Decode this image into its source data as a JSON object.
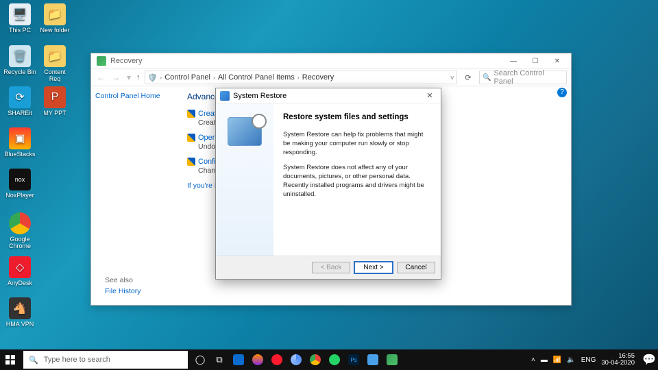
{
  "desktop_icons": {
    "this_pc": "This PC",
    "new_folder": "New folder",
    "recycle_bin": "Recycle Bin",
    "content_req": "Content Req",
    "shareit": "SHAREit",
    "my_ppt": "MY PPT",
    "bluestacks": "BlueStacks",
    "noxplayer": "NoxPlayer",
    "chrome": "Google Chrome",
    "anydesk": "AnyDesk",
    "hmavpn": "HMA VPN"
  },
  "cp": {
    "title": "Recovery",
    "breadcrumb": [
      "Control Panel",
      "All Control Panel Items",
      "Recovery"
    ],
    "search_placeholder": "Search Control Panel",
    "home": "Control Panel Home",
    "heading": "Advanced",
    "links": {
      "create": "Create a",
      "create_desc": "Create a reco",
      "open": "Open Sys",
      "open_desc": "Undo recent",
      "configure": "Configure",
      "configure_desc": "Change resto"
    },
    "having": "If you're havi",
    "seealso": "See also",
    "filehistory": "File History"
  },
  "sr": {
    "title": "System Restore",
    "heading": "Restore system files and settings",
    "p1": "System Restore can help fix problems that might be making your computer run slowly or stop responding.",
    "p2": "System Restore does not affect any of your documents, pictures, or other personal data. Recently installed programs and drivers might be uninstalled.",
    "back": "< Back",
    "next": "Next >",
    "cancel": "Cancel"
  },
  "taskbar": {
    "search_placeholder": "Type here to search",
    "lang": "ENG",
    "time": "16:55",
    "date": "30-04-2020"
  }
}
